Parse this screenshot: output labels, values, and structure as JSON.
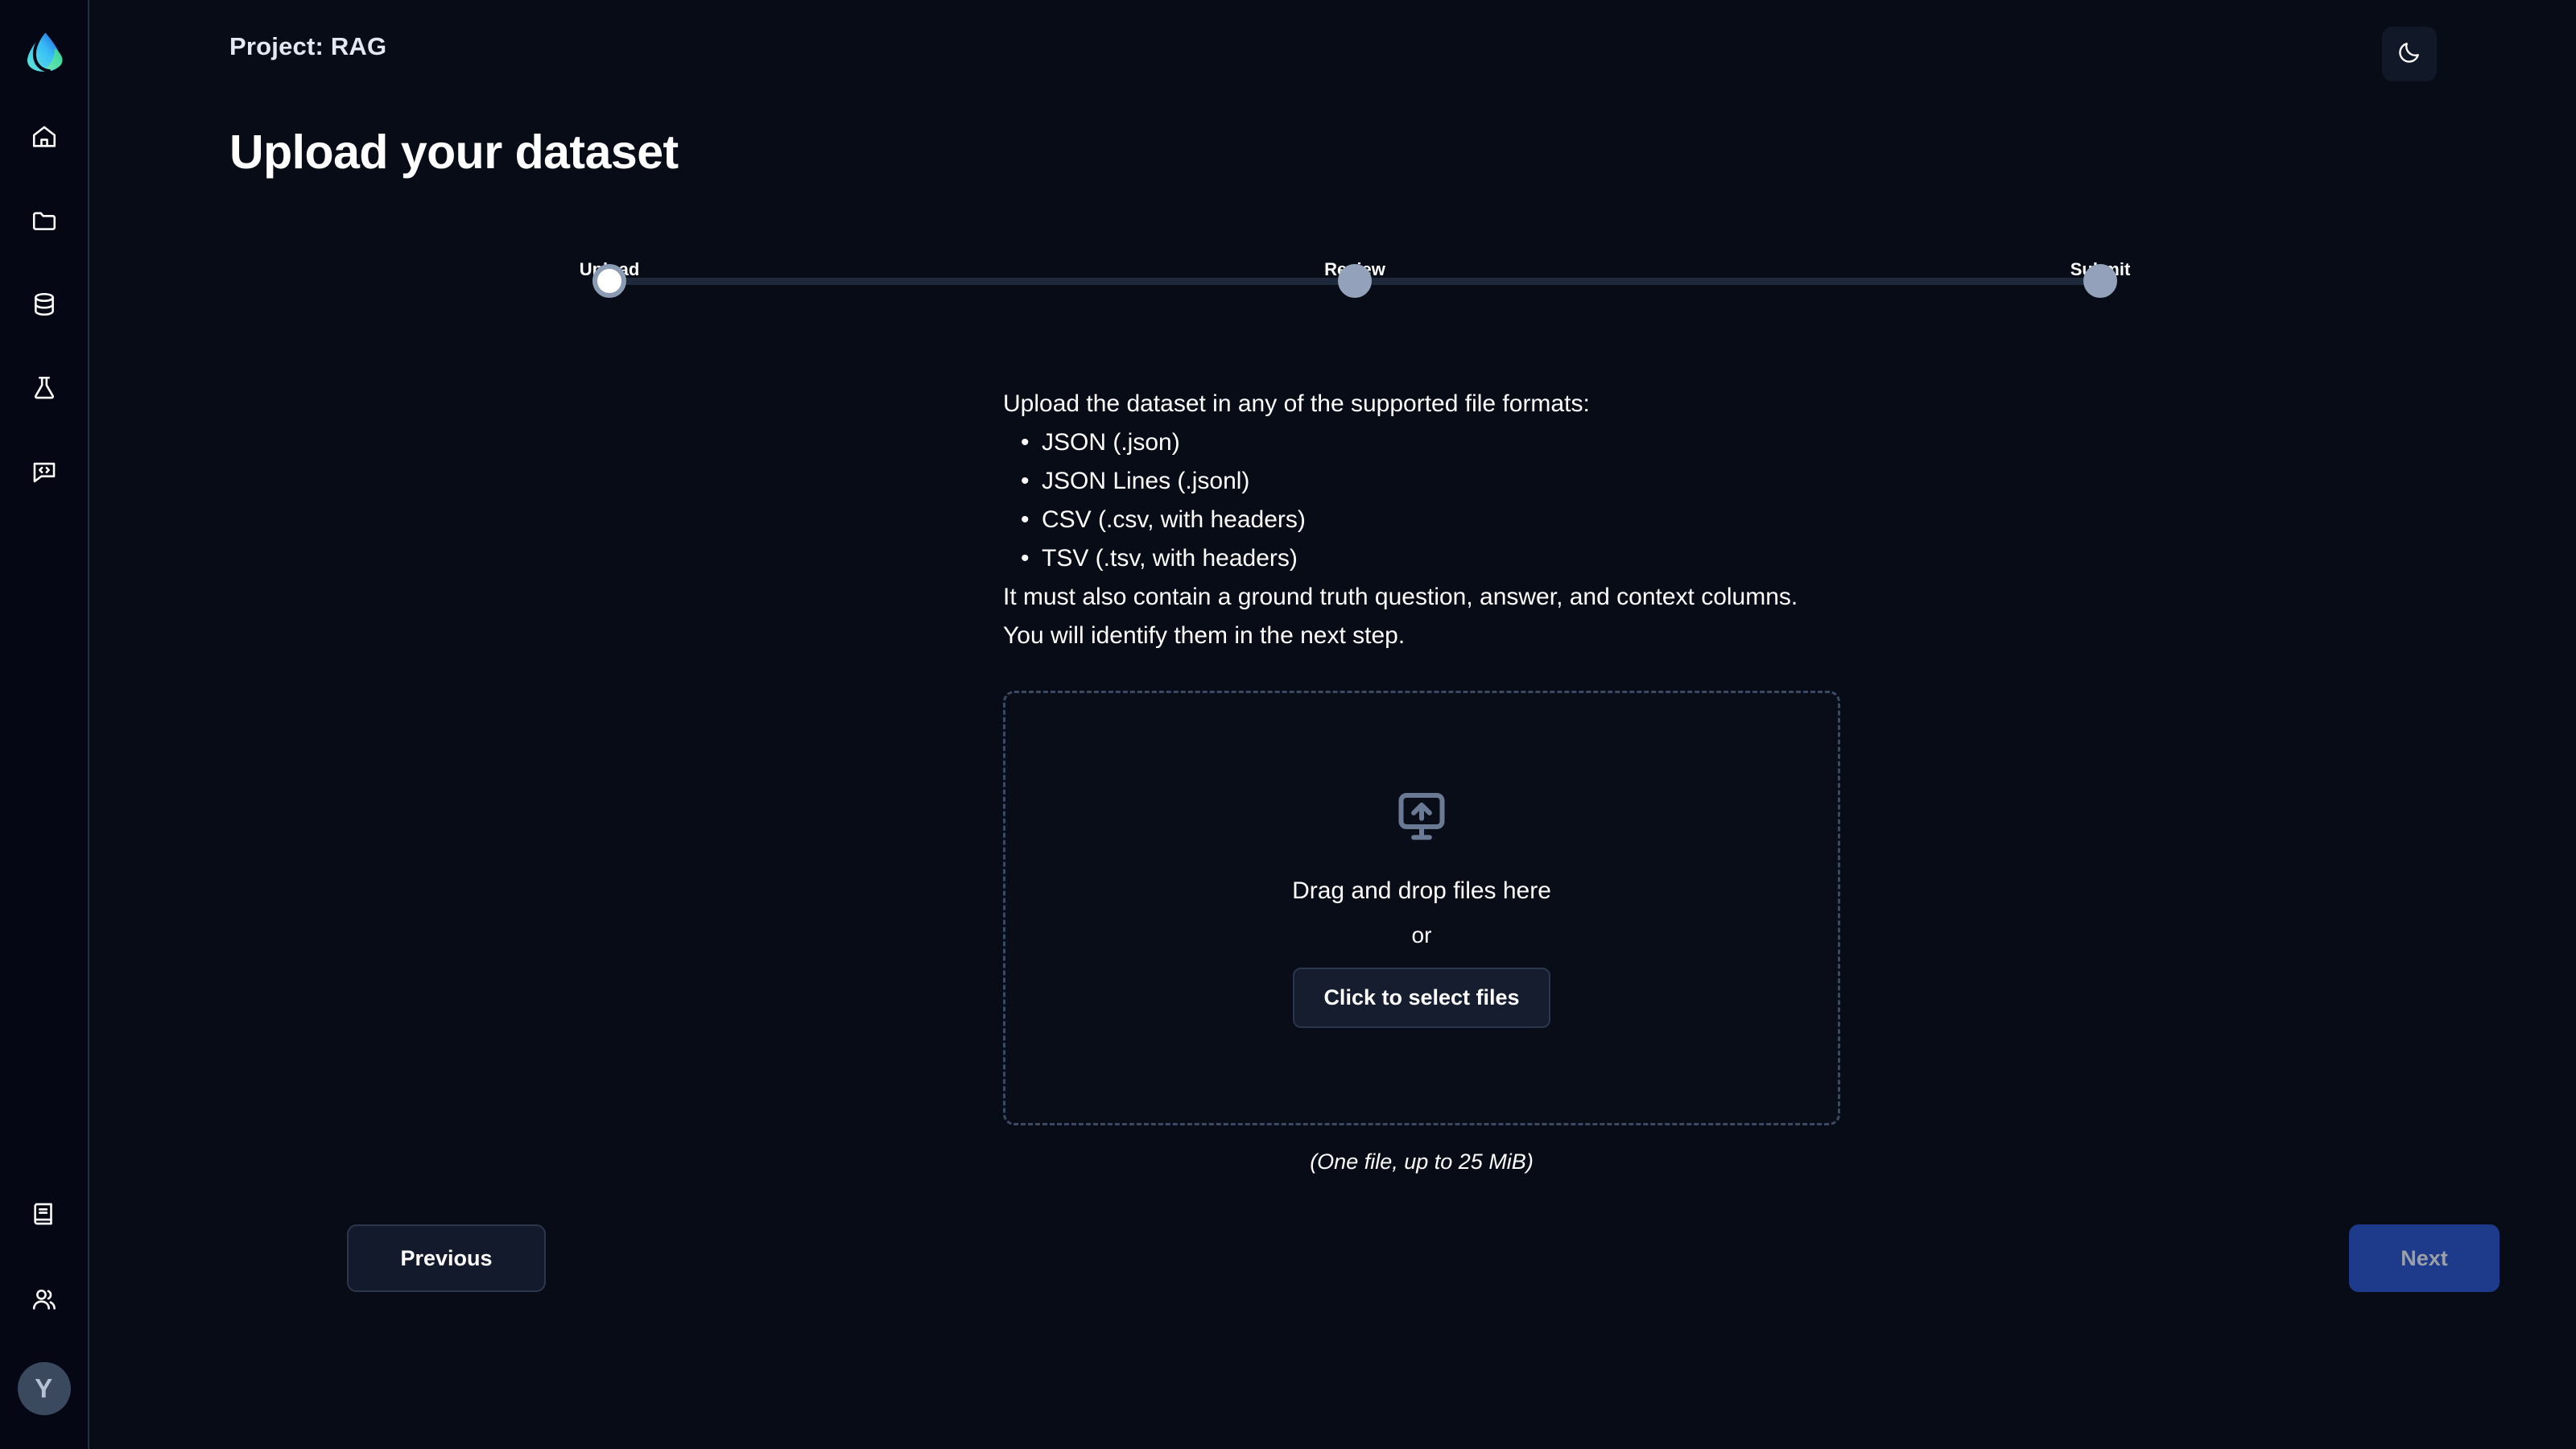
{
  "sidebar": {
    "logo": {
      "icon": "droplet-leaf-logo"
    },
    "top_items": [
      {
        "icon": "home-icon",
        "name": "sidebar-item-home"
      },
      {
        "icon": "folder-icon",
        "name": "sidebar-item-projects"
      },
      {
        "icon": "database-icon",
        "name": "sidebar-item-datasets"
      },
      {
        "icon": "flask-icon",
        "name": "sidebar-item-experiments"
      },
      {
        "icon": "code-chat-icon",
        "name": "sidebar-item-prompts"
      }
    ],
    "bottom_items": [
      {
        "icon": "book-icon",
        "name": "sidebar-item-docs"
      },
      {
        "icon": "users-icon",
        "name": "sidebar-item-team"
      }
    ],
    "avatar": {
      "initial": "Y",
      "name": "avatar"
    }
  },
  "header": {
    "project_title": "Project: RAG",
    "theme_toggle_icon": "moon-icon"
  },
  "page": {
    "heading": "Upload your dataset"
  },
  "stepper": {
    "steps": [
      {
        "label": "Upload",
        "state": "active",
        "position_pct": 0
      },
      {
        "label": "Review",
        "state": "inactive",
        "position_pct": 50
      },
      {
        "label": "Submit",
        "state": "inactive",
        "position_pct": 100
      }
    ]
  },
  "instructions": {
    "intro": "Upload the dataset in any of the supported file formats:",
    "formats": [
      "JSON (.json)",
      "JSON Lines (.jsonl)",
      "CSV (.csv, with headers)",
      "TSV (.tsv, with headers)"
    ],
    "outro": "It must also contain a ground truth question, answer, and context columns. You will identify them in the next step."
  },
  "dropzone": {
    "icon": "monitor-upload-icon",
    "drag_text": "Drag and drop files here",
    "or_text": "or",
    "select_button": "Click to select files",
    "hint": "(One file, up to 25 MiB)"
  },
  "footer": {
    "previous_label": "Previous",
    "next_label": "Next"
  },
  "colors": {
    "background": "#080c16",
    "sidebar_background": "#050814",
    "accent_blue": "#1e3a8a",
    "track": "#1e293b",
    "step_inactive": "#93a2ba",
    "text_primary": "#ffffff",
    "next_disabled_text": "#9aa0a8"
  }
}
